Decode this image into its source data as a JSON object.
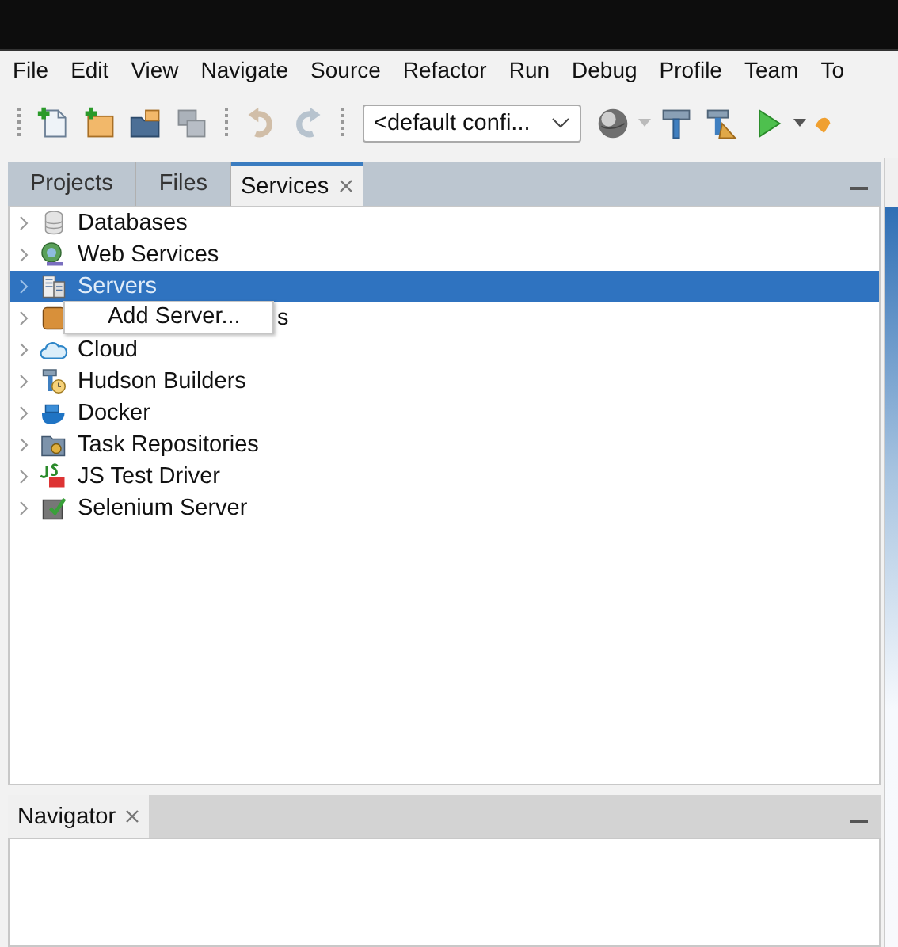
{
  "menu_bar": [
    "File",
    "Edit",
    "View",
    "Navigate",
    "Source",
    "Refactor",
    "Run",
    "Debug",
    "Profile",
    "Team",
    "To"
  ],
  "toolbar": {
    "buttons": [
      {
        "kind": "new-file",
        "disabled": false
      },
      {
        "kind": "new-project",
        "disabled": false
      },
      {
        "kind": "open-project",
        "disabled": false
      },
      {
        "kind": "save-all",
        "disabled": true
      },
      {
        "kind": "undo",
        "disabled": true
      },
      {
        "kind": "redo",
        "disabled": true
      }
    ],
    "config": {
      "value": "<default confi..."
    },
    "actions": [
      {
        "kind": "globe"
      },
      {
        "kind": "build"
      },
      {
        "kind": "clean-build"
      },
      {
        "kind": "run"
      },
      {
        "kind": "more"
      }
    ]
  },
  "services_panel": {
    "tabs": [
      {
        "label": "Projects",
        "selected": false,
        "closable": false
      },
      {
        "label": "Files",
        "selected": false,
        "closable": false
      },
      {
        "label": "Services",
        "selected": true,
        "closable": true
      }
    ],
    "tree": [
      {
        "kind": "database",
        "label": "Databases",
        "selected": false,
        "covered": false
      },
      {
        "kind": "web",
        "label": "Web Services",
        "selected": false,
        "covered": false
      },
      {
        "kind": "server",
        "label": "Servers",
        "selected": true,
        "covered": false
      },
      {
        "kind": "repository",
        "label": "s",
        "selected": false,
        "covered": true
      },
      {
        "kind": "cloud",
        "label": "Cloud",
        "selected": false,
        "covered": false
      },
      {
        "kind": "builder",
        "label": "Hudson Builders",
        "selected": false,
        "covered": false
      },
      {
        "kind": "docker",
        "label": "Docker",
        "selected": false,
        "covered": false
      },
      {
        "kind": "tasks",
        "label": "Task Repositories",
        "selected": false,
        "covered": false
      },
      {
        "kind": "jstest",
        "label": "JS Test Driver",
        "selected": false,
        "covered": false
      },
      {
        "kind": "selenium",
        "label": "Selenium Server",
        "selected": false,
        "covered": false
      }
    ],
    "context_menu": [
      "Add Server..."
    ]
  },
  "navigator_panel": {
    "tabs": [
      {
        "label": "Navigator",
        "selected": true,
        "closable": true
      }
    ]
  }
}
